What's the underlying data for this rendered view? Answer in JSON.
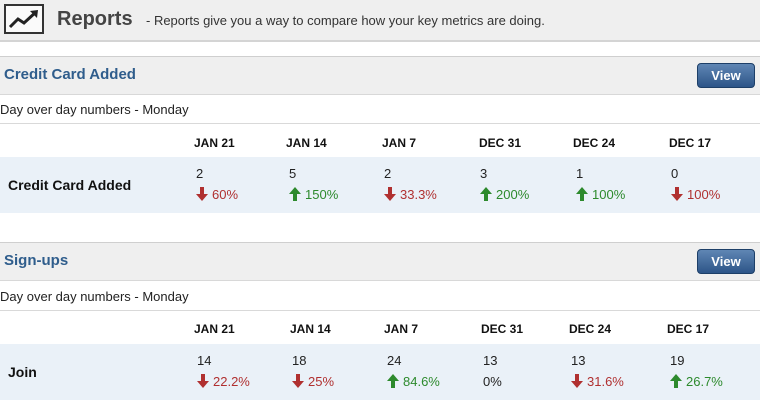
{
  "header": {
    "title": "Reports",
    "description": "- Reports give you a way to compare how your key metrics are doing."
  },
  "colors": {
    "accent": "#2f5d8c",
    "up": "#2d8a2d",
    "down": "#b03030",
    "row_bg": "#eaf1f8"
  },
  "reports": [
    {
      "title": "Credit Card Added",
      "view_label": "View",
      "subtitle": "Day over day numbers - Monday",
      "columns": [
        "JAN 21",
        "JAN 14",
        "JAN 7",
        "DEC 31",
        "DEC 24",
        "DEC 17"
      ],
      "row_label": "Credit Card Added",
      "cells": [
        {
          "value": "2",
          "change": "60%",
          "dir": "down"
        },
        {
          "value": "5",
          "change": "150%",
          "dir": "up"
        },
        {
          "value": "2",
          "change": "33.3%",
          "dir": "down"
        },
        {
          "value": "3",
          "change": "200%",
          "dir": "up"
        },
        {
          "value": "1",
          "change": "100%",
          "dir": "up"
        },
        {
          "value": "0",
          "change": "100%",
          "dir": "down"
        }
      ]
    },
    {
      "title": "Sign-ups",
      "view_label": "View",
      "subtitle": "Day over day numbers - Monday",
      "columns": [
        "JAN 21",
        "JAN 14",
        "JAN 7",
        "DEC 31",
        "DEC 24",
        "DEC 17"
      ],
      "row_label": "Join",
      "cells": [
        {
          "value": "14",
          "change": "22.2%",
          "dir": "down"
        },
        {
          "value": "18",
          "change": "25%",
          "dir": "down"
        },
        {
          "value": "24",
          "change": "84.6%",
          "dir": "up"
        },
        {
          "value": "13",
          "change": "0%",
          "dir": "flat"
        },
        {
          "value": "13",
          "change": "31.6%",
          "dir": "down"
        },
        {
          "value": "19",
          "change": "26.7%",
          "dir": "up"
        }
      ]
    }
  ]
}
